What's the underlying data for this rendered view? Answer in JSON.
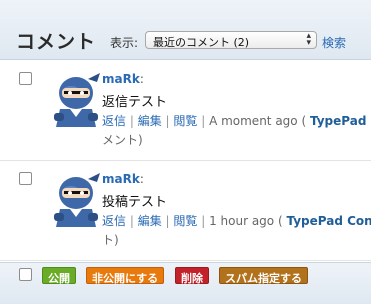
{
  "header": {
    "title": "コメント",
    "display_label": "表示:",
    "filter_selected": "最近のコメント (2)",
    "search_label": "検索"
  },
  "comments": [
    {
      "author": "maRk",
      "body": "返信テスト",
      "reply": "返信",
      "edit": "編集",
      "view": "閲覧",
      "time": "A moment ago (",
      "source": "TypePad C",
      "time_cont": "メント)"
    },
    {
      "author": "maRk",
      "body": "投稿テスト",
      "reply": "返信",
      "edit": "編集",
      "view": "閲覧",
      "time": "1 hour ago (",
      "source": "TypePad Conn",
      "time_cont": "ト)"
    }
  ],
  "actions": {
    "publish": "公開",
    "unpublish": "非公開にする",
    "delete": "削除",
    "spam": "スパム指定する"
  },
  "colors": {
    "link": "#2a6ab4",
    "publish": "#6aac27",
    "unpublish": "#e8790c",
    "delete": "#c2222a",
    "spam": "#b2711b"
  },
  "icons": {
    "avatar": "ninja-avatar-icon",
    "select_arrow": "select-updown-icon"
  }
}
